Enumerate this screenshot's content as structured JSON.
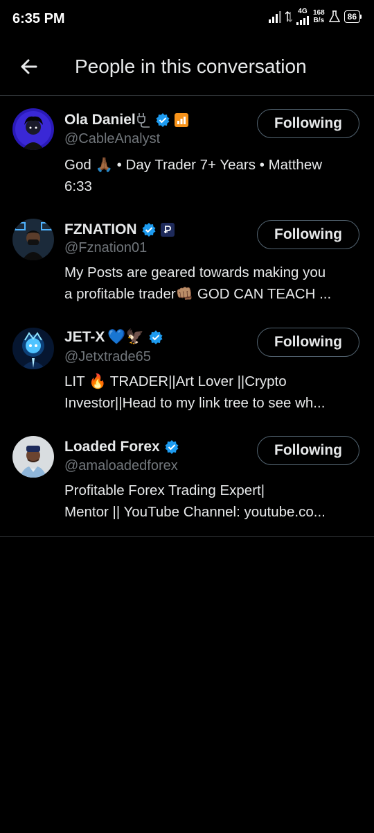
{
  "status_bar": {
    "time": "6:35 PM",
    "network": "4G",
    "speed_value": "168",
    "speed_unit": "B/s",
    "battery": "86"
  },
  "header": {
    "title": "People in this conversation",
    "back_icon": "arrow-left-icon"
  },
  "colors": {
    "background": "#000000",
    "text": "#e7e9ea",
    "secondary_text": "#71767b",
    "verified": "#1d9bf0",
    "divider": "#2f3336"
  },
  "people": [
    {
      "name": "Ola Daniel",
      "handle": "@CableAnalyst",
      "bio_lines": [
        "God 🙏🏾 • Day Trader 7+ Years • Matthew",
        "6:33"
      ],
      "button": "Following",
      "badges": [
        "plug-icon",
        "verified-badge-icon",
        "chart-badge-icon"
      ]
    },
    {
      "name": "FZNATION",
      "handle": "@Fznation01",
      "bio_lines": [
        "My Posts are geared towards making you",
        "a profitable trader👊🏽 GOD CAN TEACH ..."
      ],
      "button": "Following",
      "badges": [
        "verified-badge-icon",
        "p-badge-icon"
      ]
    },
    {
      "name": "JET-X",
      "name_emoji": "💙🦅",
      "handle": "@Jetxtrade65",
      "bio_lines": [
        "LIT 🔥 TRADER||Art Lover ||Crypto",
        "Investor||Head to my link tree to see wh..."
      ],
      "button": "Following",
      "badges": [
        "verified-badge-icon"
      ]
    },
    {
      "name": "Loaded Forex",
      "handle": "@amaloadedforex",
      "bio_lines": [
        "Profitable Forex Trading Expert|",
        "Mentor || YouTube Channel: youtube.co..."
      ],
      "button": "Following",
      "badges": [
        "verified-badge-icon"
      ]
    }
  ]
}
